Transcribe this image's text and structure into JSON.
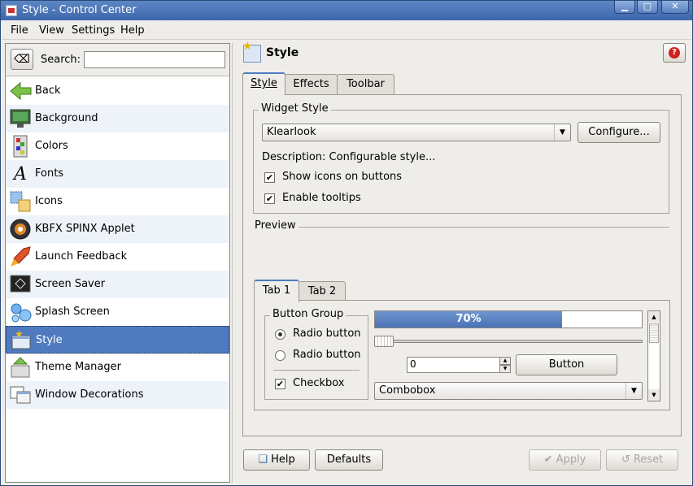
{
  "window": {
    "title": "Style - Control Center",
    "buttons": {
      "minimize": "▁",
      "maximize": "□",
      "close": "✕"
    }
  },
  "menubar": {
    "items": [
      "File",
      "View",
      "Settings",
      "Help"
    ]
  },
  "sidebar": {
    "search_label": "Search:",
    "search_value": "",
    "items": [
      {
        "label": "Back",
        "icon": "back-arrow-icon"
      },
      {
        "label": "Background",
        "icon": "monitor-icon"
      },
      {
        "label": "Colors",
        "icon": "color-palette-icon"
      },
      {
        "label": "Fonts",
        "icon": "font-icon"
      },
      {
        "label": "Icons",
        "icon": "icons-icon"
      },
      {
        "label": "KBFX SPINX Applet",
        "icon": "spinx-icon"
      },
      {
        "label": "Launch Feedback",
        "icon": "rocket-icon"
      },
      {
        "label": "Screen Saver",
        "icon": "screensaver-icon"
      },
      {
        "label": "Splash Screen",
        "icon": "bubbles-icon"
      },
      {
        "label": "Style",
        "icon": "style-icon",
        "selected": true
      },
      {
        "label": "Theme Manager",
        "icon": "theme-manager-icon"
      },
      {
        "label": "Window Decorations",
        "icon": "window-decorations-icon"
      }
    ]
  },
  "main": {
    "header_title": "Style",
    "tabs": [
      "Style",
      "Effects",
      "Toolbar"
    ],
    "active_tab": "Style",
    "widget_style": {
      "group_title": "Widget Style",
      "selected": "Klearlook",
      "configure_label": "Configure...",
      "description": "Description: Configurable style...",
      "show_icons_label": "Show icons on buttons",
      "show_icons_checked": true,
      "enable_tooltips_label": "Enable tooltips",
      "enable_tooltips_checked": true
    },
    "preview": {
      "title": "Preview",
      "tabs": [
        "Tab 1",
        "Tab 2"
      ],
      "button_group_title": "Button Group",
      "radio1_label": "Radio button",
      "radio1_checked": true,
      "radio2_label": "Radio button",
      "radio2_checked": false,
      "checkbox_label": "Checkbox",
      "checkbox_checked": true,
      "progress_percent": 70,
      "progress_text": "70%",
      "slider_value": 0,
      "spin_value": "0",
      "button_label": "Button",
      "combobox_value": "Combobox"
    },
    "footer": {
      "help_label": "Help",
      "defaults_label": "Defaults",
      "apply_label": "Apply",
      "reset_label": "Reset"
    }
  },
  "colors": {
    "selection": "#4f7abf",
    "titlebar": "#3d67ab"
  }
}
